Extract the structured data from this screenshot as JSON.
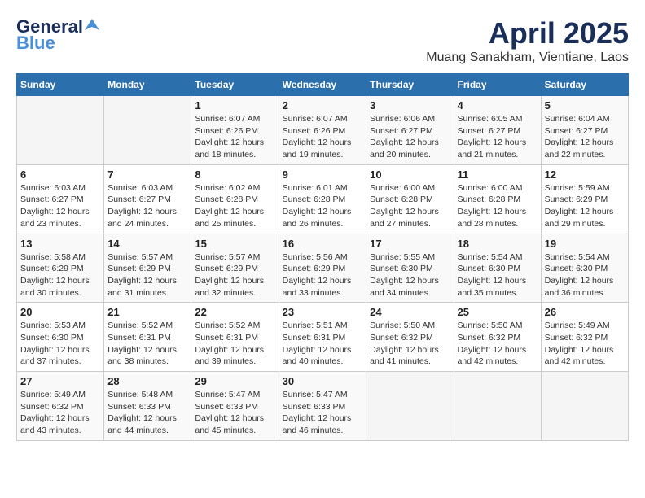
{
  "logo": {
    "general": "General",
    "blue": "Blue"
  },
  "header": {
    "month_year": "April 2025",
    "location": "Muang Sanakham, Vientiane, Laos"
  },
  "days_of_week": [
    "Sunday",
    "Monday",
    "Tuesday",
    "Wednesday",
    "Thursday",
    "Friday",
    "Saturday"
  ],
  "weeks": [
    [
      {
        "day": "",
        "info": ""
      },
      {
        "day": "",
        "info": ""
      },
      {
        "day": "1",
        "info": "Sunrise: 6:07 AM\nSunset: 6:26 PM\nDaylight: 12 hours and 18 minutes."
      },
      {
        "day": "2",
        "info": "Sunrise: 6:07 AM\nSunset: 6:26 PM\nDaylight: 12 hours and 19 minutes."
      },
      {
        "day": "3",
        "info": "Sunrise: 6:06 AM\nSunset: 6:27 PM\nDaylight: 12 hours and 20 minutes."
      },
      {
        "day": "4",
        "info": "Sunrise: 6:05 AM\nSunset: 6:27 PM\nDaylight: 12 hours and 21 minutes."
      },
      {
        "day": "5",
        "info": "Sunrise: 6:04 AM\nSunset: 6:27 PM\nDaylight: 12 hours and 22 minutes."
      }
    ],
    [
      {
        "day": "6",
        "info": "Sunrise: 6:03 AM\nSunset: 6:27 PM\nDaylight: 12 hours and 23 minutes."
      },
      {
        "day": "7",
        "info": "Sunrise: 6:03 AM\nSunset: 6:27 PM\nDaylight: 12 hours and 24 minutes."
      },
      {
        "day": "8",
        "info": "Sunrise: 6:02 AM\nSunset: 6:28 PM\nDaylight: 12 hours and 25 minutes."
      },
      {
        "day": "9",
        "info": "Sunrise: 6:01 AM\nSunset: 6:28 PM\nDaylight: 12 hours and 26 minutes."
      },
      {
        "day": "10",
        "info": "Sunrise: 6:00 AM\nSunset: 6:28 PM\nDaylight: 12 hours and 27 minutes."
      },
      {
        "day": "11",
        "info": "Sunrise: 6:00 AM\nSunset: 6:28 PM\nDaylight: 12 hours and 28 minutes."
      },
      {
        "day": "12",
        "info": "Sunrise: 5:59 AM\nSunset: 6:29 PM\nDaylight: 12 hours and 29 minutes."
      }
    ],
    [
      {
        "day": "13",
        "info": "Sunrise: 5:58 AM\nSunset: 6:29 PM\nDaylight: 12 hours and 30 minutes."
      },
      {
        "day": "14",
        "info": "Sunrise: 5:57 AM\nSunset: 6:29 PM\nDaylight: 12 hours and 31 minutes."
      },
      {
        "day": "15",
        "info": "Sunrise: 5:57 AM\nSunset: 6:29 PM\nDaylight: 12 hours and 32 minutes."
      },
      {
        "day": "16",
        "info": "Sunrise: 5:56 AM\nSunset: 6:29 PM\nDaylight: 12 hours and 33 minutes."
      },
      {
        "day": "17",
        "info": "Sunrise: 5:55 AM\nSunset: 6:30 PM\nDaylight: 12 hours and 34 minutes."
      },
      {
        "day": "18",
        "info": "Sunrise: 5:54 AM\nSunset: 6:30 PM\nDaylight: 12 hours and 35 minutes."
      },
      {
        "day": "19",
        "info": "Sunrise: 5:54 AM\nSunset: 6:30 PM\nDaylight: 12 hours and 36 minutes."
      }
    ],
    [
      {
        "day": "20",
        "info": "Sunrise: 5:53 AM\nSunset: 6:30 PM\nDaylight: 12 hours and 37 minutes."
      },
      {
        "day": "21",
        "info": "Sunrise: 5:52 AM\nSunset: 6:31 PM\nDaylight: 12 hours and 38 minutes."
      },
      {
        "day": "22",
        "info": "Sunrise: 5:52 AM\nSunset: 6:31 PM\nDaylight: 12 hours and 39 minutes."
      },
      {
        "day": "23",
        "info": "Sunrise: 5:51 AM\nSunset: 6:31 PM\nDaylight: 12 hours and 40 minutes."
      },
      {
        "day": "24",
        "info": "Sunrise: 5:50 AM\nSunset: 6:32 PM\nDaylight: 12 hours and 41 minutes."
      },
      {
        "day": "25",
        "info": "Sunrise: 5:50 AM\nSunset: 6:32 PM\nDaylight: 12 hours and 42 minutes."
      },
      {
        "day": "26",
        "info": "Sunrise: 5:49 AM\nSunset: 6:32 PM\nDaylight: 12 hours and 42 minutes."
      }
    ],
    [
      {
        "day": "27",
        "info": "Sunrise: 5:49 AM\nSunset: 6:32 PM\nDaylight: 12 hours and 43 minutes."
      },
      {
        "day": "28",
        "info": "Sunrise: 5:48 AM\nSunset: 6:33 PM\nDaylight: 12 hours and 44 minutes."
      },
      {
        "day": "29",
        "info": "Sunrise: 5:47 AM\nSunset: 6:33 PM\nDaylight: 12 hours and 45 minutes."
      },
      {
        "day": "30",
        "info": "Sunrise: 5:47 AM\nSunset: 6:33 PM\nDaylight: 12 hours and 46 minutes."
      },
      {
        "day": "",
        "info": ""
      },
      {
        "day": "",
        "info": ""
      },
      {
        "day": "",
        "info": ""
      }
    ]
  ]
}
